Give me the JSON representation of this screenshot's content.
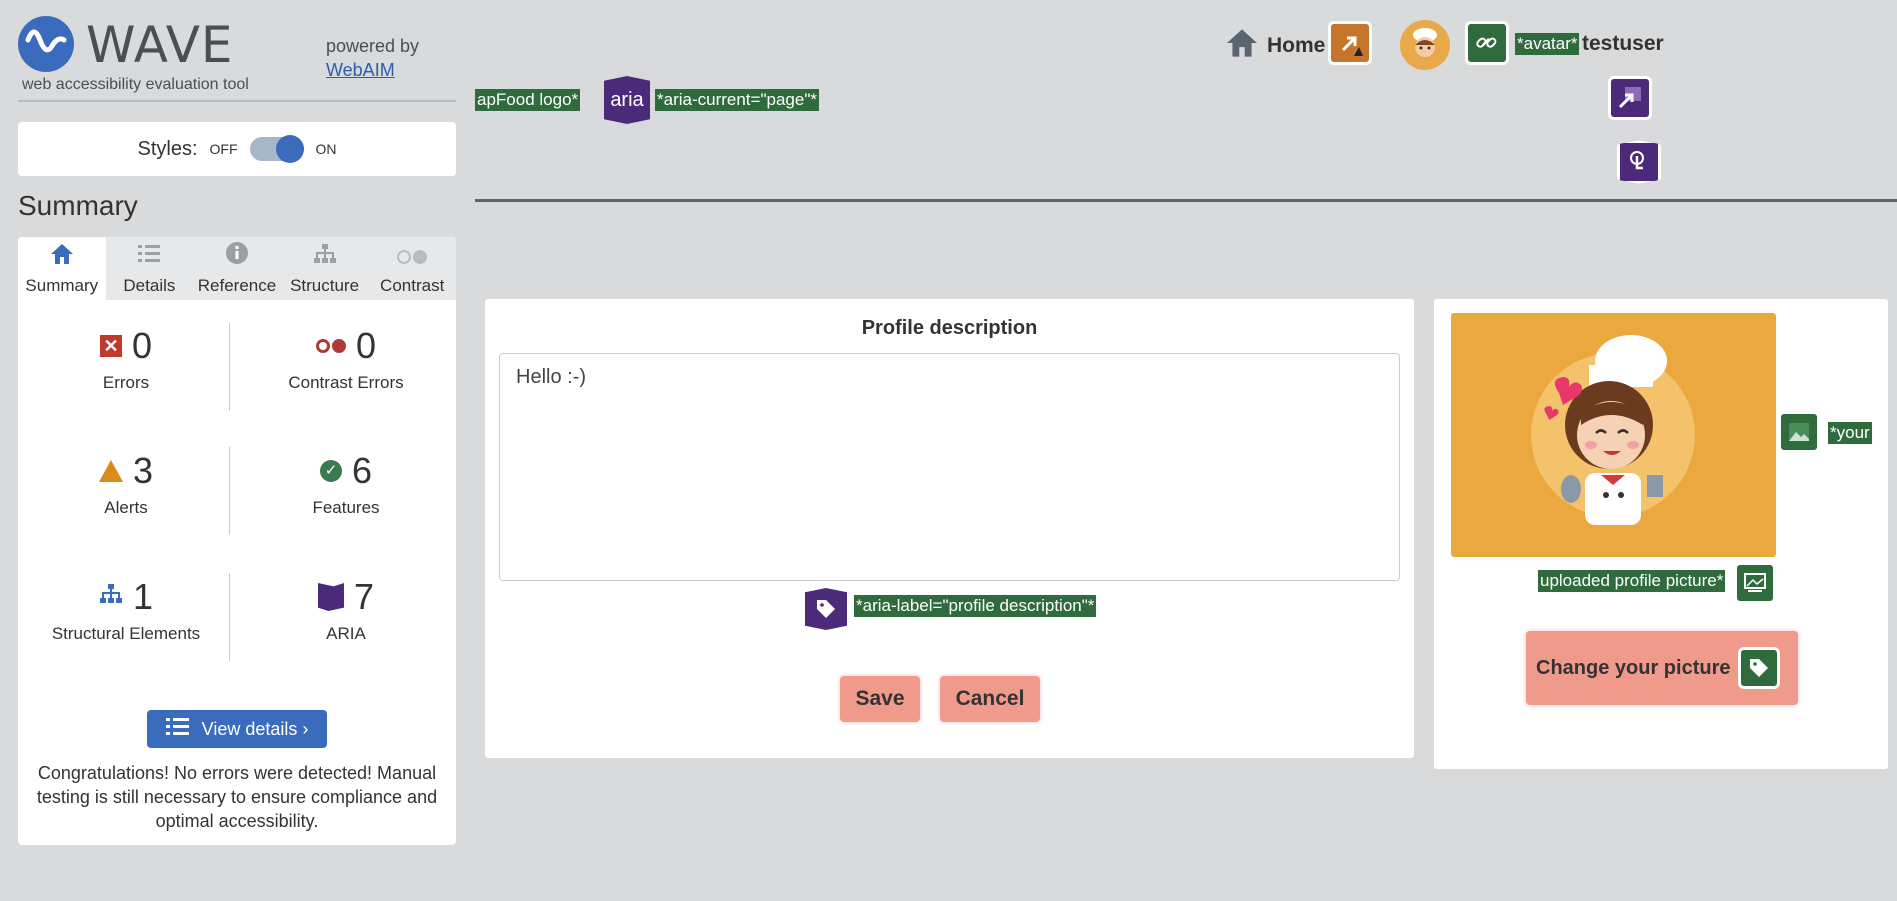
{
  "wave": {
    "logo_word": "WAVE",
    "logo_sub": "web accessibility evaluation tool",
    "powered_by": "powered by",
    "powered_link": "WebAIM",
    "styles_label": "Styles:",
    "toggle_off": "OFF",
    "toggle_on": "ON",
    "summary_title": "Summary",
    "tabs": [
      {
        "label": "Summary",
        "icon": "home-icon",
        "active": true
      },
      {
        "label": "Details",
        "icon": "list-icon",
        "active": false
      },
      {
        "label": "Reference",
        "icon": "info-icon",
        "active": false
      },
      {
        "label": "Structure",
        "icon": "sitemap-icon",
        "active": false
      },
      {
        "label": "Contrast",
        "icon": "contrast-icon",
        "active": false
      }
    ],
    "stats": {
      "errors": {
        "value": "0",
        "label": "Errors"
      },
      "contrast": {
        "value": "0",
        "label": "Contrast Errors"
      },
      "alerts": {
        "value": "3",
        "label": "Alerts"
      },
      "features": {
        "value": "6",
        "label": "Features"
      },
      "structural": {
        "value": "1",
        "label": "Structural Elements"
      },
      "aria": {
        "value": "7",
        "label": "ARIA"
      }
    },
    "view_details": "View details ›",
    "congrats": "Congratulations! No errors were detected! Manual testing is still necessary to ensure compliance and optimal accessibility."
  },
  "header": {
    "logo_tag": "apFood logo*",
    "aria_badge": "aria",
    "aria_current_tag": "*aria-current=\"page\"*",
    "home_label": "Home",
    "avatar_tag": "*avatar*",
    "username": "testuser"
  },
  "profile": {
    "title": "Profile description",
    "text": "Hello :-)",
    "aria_label_tag": "*aria-label=\"profile description\"*",
    "save": "Save",
    "cancel": "Cancel"
  },
  "picture": {
    "alt_tag_partial": "*your",
    "uploaded_tag": "uploaded profile picture*",
    "change_button": "Change your picture"
  },
  "colors": {
    "wave_blue": "#3b6bbd",
    "feature_green": "#2f6b3d",
    "aria_purple": "#4c2a7a",
    "button_salmon": "#f09a8c",
    "picture_bg": "#eba83f"
  }
}
